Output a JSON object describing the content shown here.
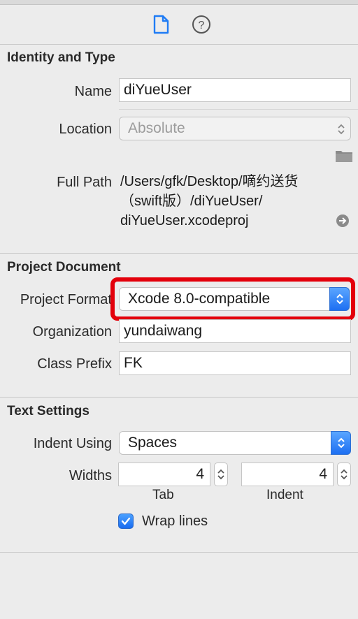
{
  "toolbar": {
    "icons": [
      "file-inspector-icon",
      "quick-help-icon"
    ]
  },
  "identity": {
    "section_title": "Identity and Type",
    "name_label": "Name",
    "name_value": "diYueUser",
    "location_label": "Location",
    "location_value": "Absolute",
    "full_path_label": "Full Path",
    "full_path_lines": [
      "/Users/gfk/Desktop/嘀约送货",
      "（swift版）/diYueUser/",
      "diYueUser.xcodeproj"
    ]
  },
  "project_document": {
    "section_title": "Project Document",
    "format_label": "Project Format",
    "format_value": "Xcode 8.0-compatible",
    "organization_label": "Organization",
    "organization_value": "yundaiwang",
    "class_prefix_label": "Class Prefix",
    "class_prefix_value": "FK"
  },
  "text_settings": {
    "section_title": "Text Settings",
    "indent_using_label": "Indent Using",
    "indent_using_value": "Spaces",
    "widths_label": "Widths",
    "tab_value": "4",
    "indent_value": "4",
    "tab_caption": "Tab",
    "indent_caption": "Indent",
    "wrap_lines_label": "Wrap lines",
    "wrap_lines_checked": true
  },
  "colors": {
    "accent_blue": "#1d6ff2",
    "highlight_red": "#e3000b"
  }
}
